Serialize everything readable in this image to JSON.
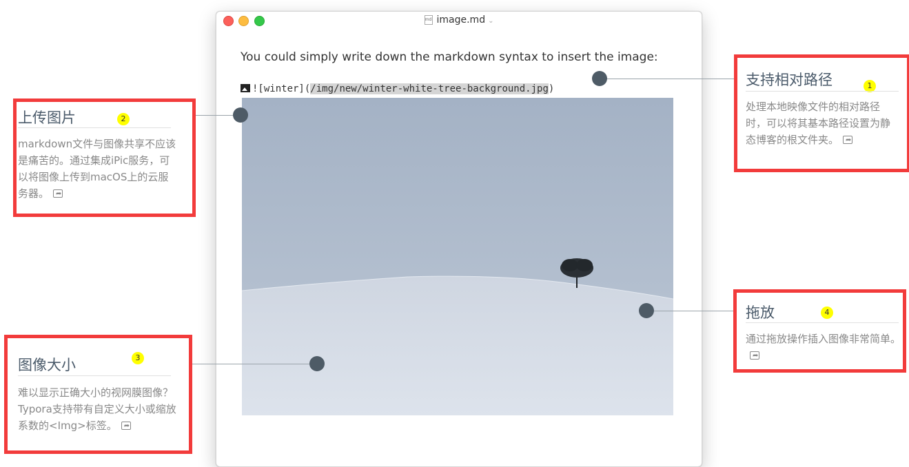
{
  "window": {
    "title": "image.md",
    "doc_icon": "md",
    "chevron": "⌄"
  },
  "editor": {
    "intro": "You could simply write down the markdown syntax to insert the image:",
    "code_prefix": "![winter](",
    "code_url": "/img/new/winter-white-tree-background.jpg",
    "code_suffix": ")"
  },
  "callouts": [
    {
      "badge": "1",
      "heading": "支持相对路径",
      "desc": "处理本地映像文件的相对路径时，可以将其基本路径设置为静态博客的根文件夹。"
    },
    {
      "badge": "2",
      "heading": "上传图片",
      "desc": "markdown文件与图像共享不应该是痛苦的。通过集成iPic服务，可以将图像上传到macOS上的云服务器。"
    },
    {
      "badge": "3",
      "heading": "图像大小",
      "desc": "难以显示正确大小的视网膜图像？Typora支持带有自定义大小或缩放系数的<Img>标签。"
    },
    {
      "badge": "4",
      "heading": "拖放",
      "desc": "通过拖放操作插入图像非常简单。"
    }
  ],
  "colors": {
    "callout_border": "#f23b3b",
    "badge": "#ffff00",
    "dot": "#4e5b66"
  }
}
